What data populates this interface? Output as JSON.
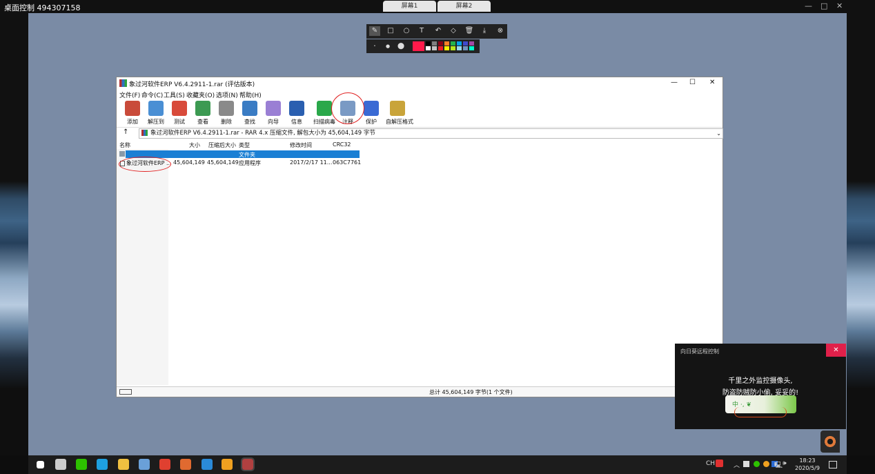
{
  "remote": {
    "title": "桌面控制 494307158",
    "tabs": [
      "屏幕1",
      "屏幕2"
    ],
    "controls": [
      "—",
      "□",
      "✕"
    ],
    "dropdown": "⌄"
  },
  "annotation": {
    "tools": [
      "✎",
      "□",
      "○",
      "T",
      "↶",
      "◇",
      "🗑",
      "⤓",
      "⊗"
    ],
    "sizes": [
      "•",
      "●",
      "⬤"
    ],
    "active_color": "#ff1a4a",
    "palette": [
      "#000000",
      "#7f7f7f",
      "#880015",
      "#ff7f27",
      "#22b14c",
      "#00a2e8",
      "#3f48cc",
      "#a349a4",
      "#ffffff",
      "#c3c3c3",
      "#ed1c24",
      "#fff200",
      "#b5e61d",
      "#99d9ea",
      "#7092be",
      "#00ffcc"
    ]
  },
  "rar": {
    "title": "象过河软件ERP V6.4.2911-1.rar (评估版本)",
    "window_controls": [
      "—",
      "☐",
      "✕"
    ],
    "menu": [
      "文件(F)",
      "命令(C)",
      "工具(S)",
      "收藏夹(O)",
      "选项(N)",
      "帮助(H)"
    ],
    "toolbar": [
      {
        "label": "添加",
        "color": "#c94b3a"
      },
      {
        "label": "解压到",
        "color": "#4a8fd4"
      },
      {
        "label": "测试",
        "color": "#d84a3a"
      },
      {
        "label": "查看",
        "color": "#3c9a52"
      },
      {
        "label": "删除",
        "color": "#8a8a8a"
      },
      {
        "label": "查找",
        "color": "#3a7cc4"
      },
      {
        "label": "向导",
        "color": "#9a7fd4"
      },
      {
        "label": "信息",
        "color": "#2a5fb0"
      },
      {
        "label": "扫描病毒",
        "color": "#2aa84a"
      },
      {
        "label": "注释",
        "color": "#7a9ac4"
      },
      {
        "label": "保护",
        "color": "#3a6ad4"
      },
      {
        "label": "自解压格式",
        "color": "#c9a43a"
      }
    ],
    "up_arrow": "↑",
    "path": "象过河软件ERP V6.4.2911-1.rar - RAR 4.x 压缩文件, 解包大小为 45,604,149 字节",
    "columns": [
      "名称",
      "大小",
      "压缩后大小",
      "类型",
      "修改时间",
      "CRC32"
    ],
    "rows": [
      {
        "name": "",
        "size": "",
        "packed": "",
        "type": "文件夹",
        "modified": "",
        "crc": ""
      },
      {
        "name": "象过河软件ERP ...",
        "size": "45,604,149",
        "packed": "45,604,149",
        "type": "应用程序",
        "modified": "2017/2/17 11...",
        "crc": "063C7761"
      }
    ],
    "status": "总计 45,604,149 字节(1 个文件)"
  },
  "popup": {
    "title": "向日葵远程控制",
    "close": "✕",
    "line1": "千里之外监控摄像头,",
    "line2": "防盗防贼防小偷, 妥妥的!",
    "banner_text": "中 ·, ❦"
  },
  "taskbar": {
    "apps": [
      {
        "name": "start",
        "color": "#ffffff"
      },
      {
        "name": "task-view",
        "color": "#cccccc"
      },
      {
        "name": "wechat",
        "color": "#2dc100"
      },
      {
        "name": "browser-search",
        "color": "#1ea0e0"
      },
      {
        "name": "file-explorer",
        "color": "#f0c040"
      },
      {
        "name": "notepad",
        "color": "#6aa0d8"
      },
      {
        "name": "chrome",
        "color": "#e04030"
      },
      {
        "name": "paint",
        "color": "#e06a30"
      },
      {
        "name": "wps",
        "color": "#2a8ad8"
      },
      {
        "name": "sunflower",
        "color": "#f0a020"
      },
      {
        "name": "winrar",
        "color": "#b04040"
      }
    ],
    "tray_text": "CH",
    "clock_time": "18:23",
    "clock_date": "2020/5/9"
  }
}
